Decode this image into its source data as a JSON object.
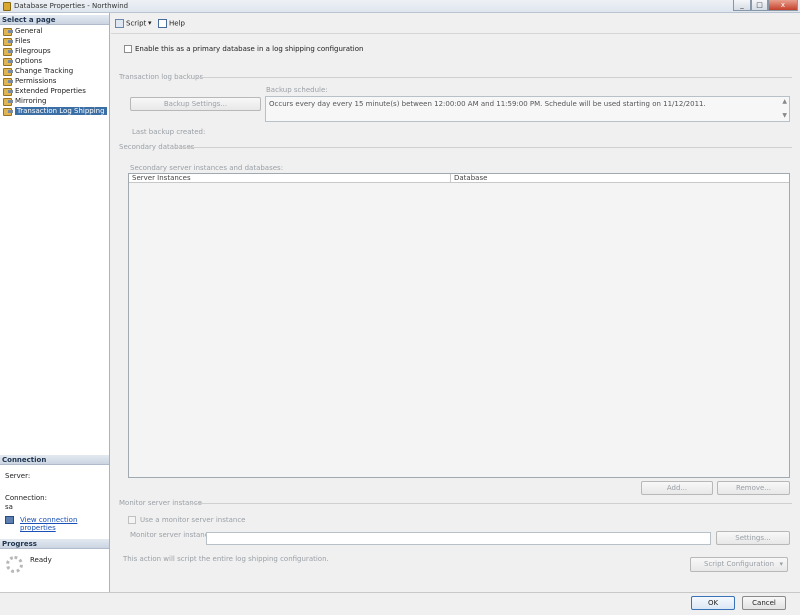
{
  "window": {
    "title": "Database Properties - Northwind",
    "min": "_",
    "max": "□",
    "close": "x"
  },
  "left": {
    "select_page_header": "Select a page",
    "items": [
      {
        "label": "General"
      },
      {
        "label": "Files"
      },
      {
        "label": "Filegroups"
      },
      {
        "label": "Options"
      },
      {
        "label": "Change Tracking"
      },
      {
        "label": "Permissions"
      },
      {
        "label": "Extended Properties"
      },
      {
        "label": "Mirroring"
      },
      {
        "label": "Transaction Log Shipping"
      }
    ],
    "connection_header": "Connection",
    "server_label": "Server:",
    "connection_label": "Connection:",
    "connection_value": "sa",
    "view_connection_link": "View connection properties",
    "progress_header": "Progress",
    "progress_status": "Ready"
  },
  "toolbar": {
    "script_label": "Script",
    "help_label": "Help"
  },
  "main": {
    "enable_primary_label": "Enable this as a primary database in a log shipping configuration",
    "tlog_backups_label": "Transaction log backups",
    "backup_settings_button": "Backup Settings...",
    "backup_schedule_label": "Backup schedule:",
    "backup_schedule_text": "Occurs every day every 15 minute(s) between 12:00:00 AM and 11:59:00 PM. Schedule will be used starting on 11/12/2011.",
    "last_backup_label": "Last backup created:",
    "secondary_db_label": "Secondary databases",
    "secondary_instances_label": "Secondary server instances and databases:",
    "col_server_instances": "Server Instances",
    "col_database": "Database",
    "add_button": "Add...",
    "remove_button": "Remove...",
    "monitor_instance_header": "Monitor server instance",
    "use_monitor_label": "Use a monitor server instance",
    "monitor_instance_label": "Monitor server instance:",
    "settings_button": "Settings...",
    "script_note": "This action will script the entire log shipping configuration.",
    "script_config_button": "Script Configuration"
  },
  "footer": {
    "ok_button": "OK",
    "cancel_button": "Cancel"
  }
}
